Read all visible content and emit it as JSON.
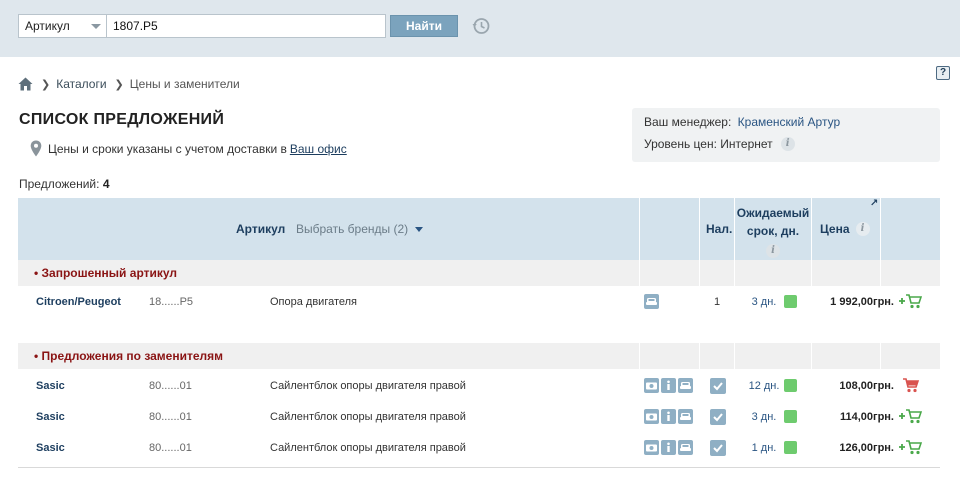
{
  "search": {
    "type_value": "Артикул",
    "query_value": "1807.P5",
    "button_label": "Найти"
  },
  "breadcrumb": {
    "items": [
      "Каталоги",
      "Цены и заменители"
    ]
  },
  "page": {
    "title": "СПИСОК ПРЕДЛОЖЕНИЙ",
    "delivery_text": "Цены и сроки указаны с учетом доставки в",
    "delivery_link": "Ваш офис",
    "offers_label": "Предложений:",
    "offers_count": "4",
    "help_label": "?"
  },
  "manager": {
    "manager_label": "Ваш менеджер:",
    "manager_name": "Краменский Артур",
    "price_level_label": "Уровень цен:",
    "price_level_value": "Интернет"
  },
  "table": {
    "col_artikul": "Артикул",
    "col_brands": "Выбрать бренды (2)",
    "col_nal": "Нал.",
    "col_srok_line1": "Ожидаемый",
    "col_srok_line2": "срок, дн.",
    "col_price": "Цена",
    "info_glyph": "i"
  },
  "sections": {
    "requested": "• Запрошенный артикул",
    "replacements": "• Предложения по заменителям"
  },
  "requested_rows": [
    {
      "brand": "Citroen/Peugeot",
      "article": "18......P5",
      "description": "Опора двигателя",
      "qty": "1",
      "days": "3 дн.",
      "price": "1 992,00грн."
    }
  ],
  "replacement_rows": [
    {
      "brand": "Sasic",
      "article": "80......01",
      "description": "Сайлентблок опоры двигателя правой",
      "days": "12 дн.",
      "price": "108,00грн."
    },
    {
      "brand": "Sasic",
      "article": "80......01",
      "description": "Сайлентблок опоры двигателя правой",
      "days": "3 дн.",
      "price": "114,00грн."
    },
    {
      "brand": "Sasic",
      "article": "80......01",
      "description": "Сайлентблок опоры двигателя правой",
      "days": "1 дн.",
      "price": "126,00грн."
    }
  ],
  "colors": {
    "accent": "#2a5583",
    "header_bg": "#d3e2ec",
    "status_green": "#6ecb6e",
    "section_red": "#8a1414",
    "cart_green": "#4aa84a",
    "cart_red": "#d9534f"
  },
  "icons": {
    "home": "home-icon",
    "history": "history-icon",
    "pin": "location-pin-icon",
    "car": "car-icon",
    "info": "info-icon",
    "cart_add": "add-to-cart-icon",
    "check": "check-icon"
  }
}
